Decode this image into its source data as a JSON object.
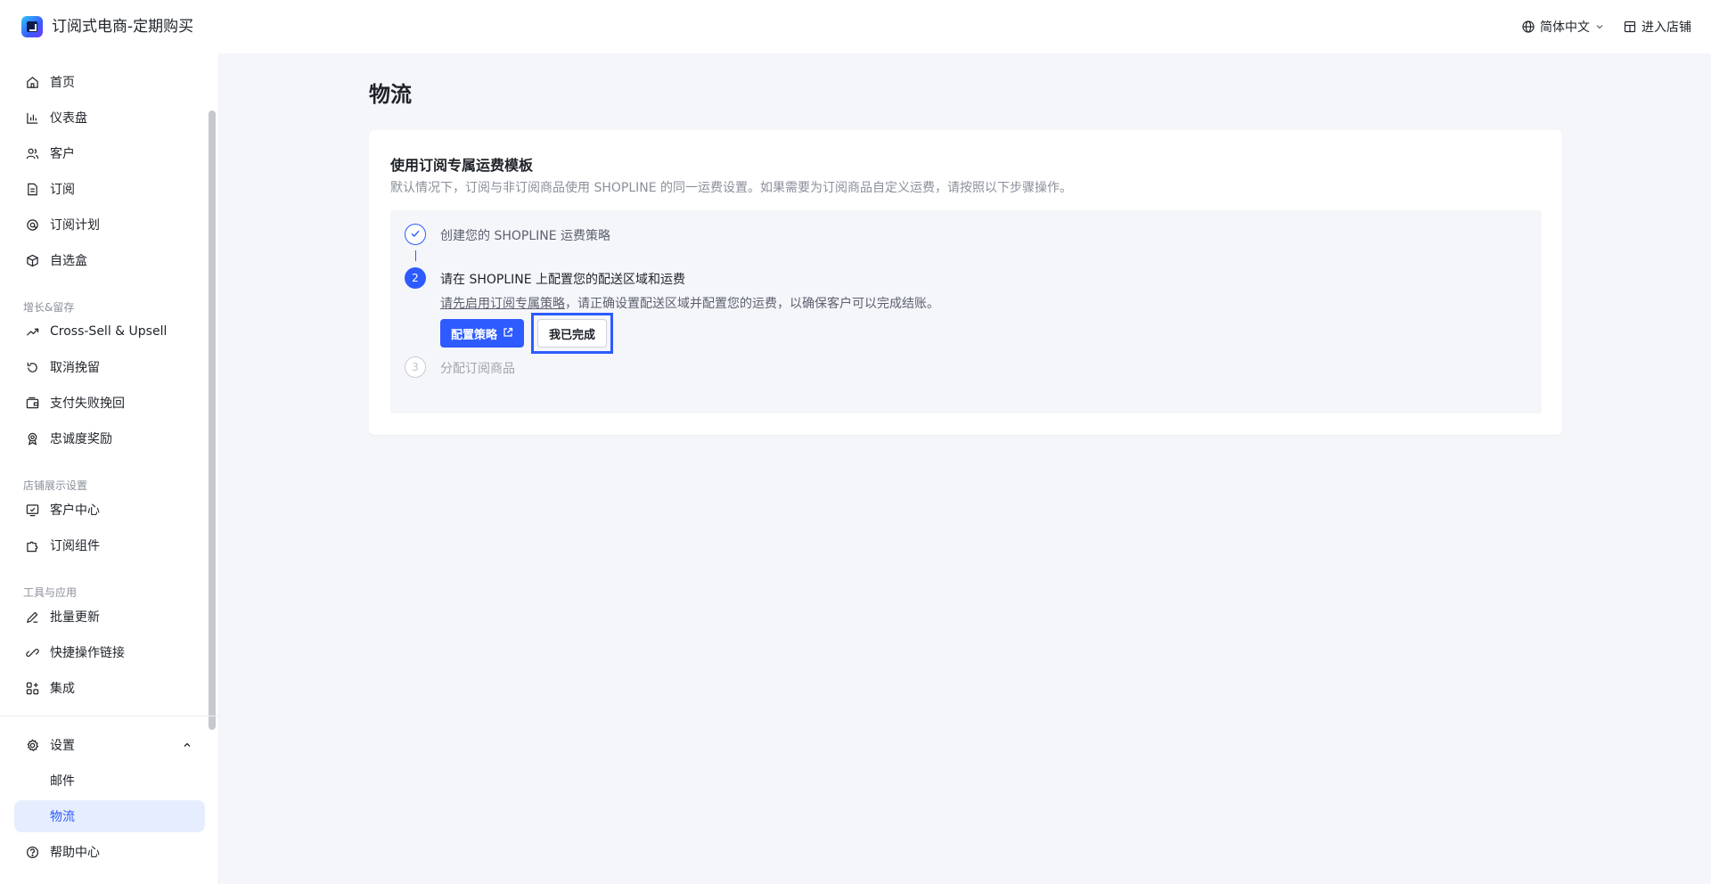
{
  "app": {
    "title": "订阅式电商-定期购买"
  },
  "header": {
    "language": "简体中文",
    "enter_store": "进入店铺"
  },
  "sidebar": {
    "items": [
      {
        "label": "首页",
        "icon": "home-icon"
      },
      {
        "label": "仪表盘",
        "icon": "bar-chart-icon"
      },
      {
        "label": "客户",
        "icon": "users-icon"
      },
      {
        "label": "订阅",
        "icon": "document-icon"
      },
      {
        "label": "订阅计划",
        "icon": "plan-icon"
      },
      {
        "label": "自选盒",
        "icon": "box-icon"
      }
    ],
    "sections": [
      {
        "label": "增长&留存",
        "items": [
          {
            "label": "Cross-Sell & Upsell",
            "icon": "trend-up-icon"
          },
          {
            "label": "取消挽留",
            "icon": "undo-icon"
          },
          {
            "label": "支付失败挽回",
            "icon": "wallet-icon"
          },
          {
            "label": "忠诚度奖励",
            "icon": "medal-icon"
          }
        ]
      },
      {
        "label": "店铺展示设置",
        "items": [
          {
            "label": "客户中心",
            "icon": "screen-icon"
          },
          {
            "label": "订阅组件",
            "icon": "puzzle-icon"
          }
        ]
      },
      {
        "label": "工具与应用",
        "items": [
          {
            "label": "批量更新",
            "icon": "pen-icon"
          },
          {
            "label": "快捷操作链接",
            "icon": "link-icon"
          },
          {
            "label": "集成",
            "icon": "apps-icon"
          }
        ]
      }
    ],
    "settings": {
      "label": "设置",
      "icon": "gear-icon",
      "children": [
        {
          "label": "邮件"
        },
        {
          "label": "物流"
        }
      ]
    },
    "help": {
      "label": "帮助中心",
      "icon": "help-icon"
    }
  },
  "main": {
    "page_title": "物流",
    "card": {
      "title": "使用订阅专属运费模板",
      "description": "默认情况下，订阅与非订阅商品使用 SHOPLINE 的同一运费设置。如果需要为订阅商品自定义运费，请按照以下步骤操作。",
      "steps": [
        {
          "number": "1",
          "title": "创建您的 SHOPLINE 运费策略",
          "status": "done"
        },
        {
          "number": "2",
          "title": "请在 SHOPLINE 上配置您的配送区域和运费",
          "status": "current",
          "link_text": "请先启用订阅专属策略",
          "desc_rest": "，请正确设置配送区域并配置您的运费，以确保客户可以完成结账。",
          "primary_button": "配置策略",
          "secondary_button": "我已完成"
        },
        {
          "number": "3",
          "title": "分配订阅商品",
          "status": "pending"
        }
      ]
    }
  },
  "colors": {
    "accent": "#2d5bff",
    "active_bg": "#e6edff",
    "page_bg": "#f5f6fa"
  }
}
